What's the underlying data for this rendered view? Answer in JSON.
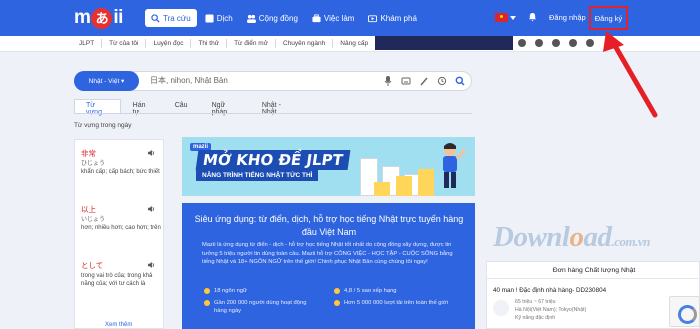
{
  "header": {
    "logo_text_a": "m",
    "logo_text_b": "ii",
    "logo_kana": "あ",
    "nav": [
      {
        "label": "Tra cứu",
        "icon": "search-icon",
        "active": true
      },
      {
        "label": "Dịch",
        "icon": "translate-icon",
        "active": false
      },
      {
        "label": "Cộng đồng",
        "icon": "community-icon",
        "active": false
      },
      {
        "label": "Việc làm",
        "icon": "briefcase-icon",
        "active": false
      },
      {
        "label": "Khám phá",
        "icon": "explore-icon",
        "active": false
      }
    ],
    "login": "Đăng nhập",
    "register": "Đăng ký"
  },
  "subnav": [
    "JLPT",
    "Từ của tôi",
    "Luyện đọc",
    "Thi thử",
    "Từ điển mở",
    "Chuyên ngành",
    "Nâng cấp"
  ],
  "search": {
    "lang": "Nhật - Việt ▾",
    "placeholder": "日本, nihon, Nhật Bản"
  },
  "tabs": [
    "Từ vựng",
    "Hán tự",
    "Câu",
    "Ngữ pháp",
    "Nhật - Nhật"
  ],
  "daily_label": "Từ vựng trong ngày",
  "vocab": [
    {
      "word": "非常",
      "reading": "ひじょう",
      "meaning": "khẩn cấp; cấp bách; bức thiết"
    },
    {
      "word": "以上",
      "reading": "いじょう",
      "meaning": "hơn; nhiều hơn; cao hơn; trên"
    },
    {
      "word": "として",
      "reading": "",
      "meaning": "trong vai trò của; trong khả năng của; với tư cách là"
    }
  ],
  "see_more": "Xem thêm",
  "banner": {
    "logo": "mazii",
    "title": "MỞ KHO ĐỀ JLPT",
    "subtitle": "NÂNG TRÌNH TIẾNG NHẬT TỨC THÌ"
  },
  "intro": {
    "title": "Siêu ứng dụng: từ điển, dịch, hỗ trợ học tiếng Nhật trực tuyến hàng đầu Việt Nam",
    "text": "Mazii là ứng dụng từ điển - dịch - hỗ trợ học tiếng Nhật tốt nhất do cộng đồng xây dựng, được tin tưởng 5 triệu người tin dùng toàn cầu. Mazii hỗ trợ CÔNG VIỆC - HỌC TẬP - CUỘC SỐNG bằng tiếng Nhật và 18+ NGÔN NGỮ trên thế giới! Chinh phục Nhật Bản cùng chúng tôi ngay!",
    "features": [
      "18 ngôn ngữ",
      "4,8 / 5 sao xếp hạng",
      "Gần 200 000 người dùng hoạt động hàng ngày",
      "Hơn 5 000 000 lượt tải trên toàn thế giới"
    ]
  },
  "watermark": {
    "a": "D",
    "b": "ownl",
    "c": "o",
    "d": "ad",
    "e": ".com.vn"
  },
  "job": {
    "header": "Đơn hàng Chất lượng Nhật",
    "title": "40 man ! Đặc định nhà hàng- DD230804",
    "meta": [
      "65 triệu ~ 67 triệu",
      "Hà Nội(Việt Nam); Tokyo(Nhật)",
      "Kỹ năng đặc định"
    ]
  },
  "colors": {
    "brand": "#2e64e0",
    "accent_red": "#e1232a"
  }
}
